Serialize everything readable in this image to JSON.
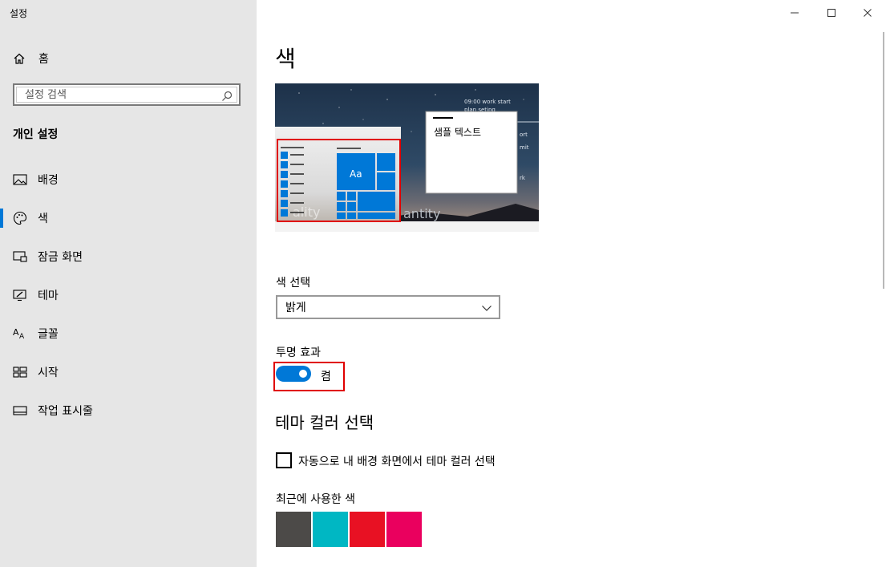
{
  "app": {
    "title": "설정"
  },
  "window_controls": {
    "minimize_icon": "minimize-icon",
    "maximize_icon": "maximize-icon",
    "close_icon": "close-icon"
  },
  "sidebar": {
    "home_label": "홈",
    "search_placeholder": "설정 검색",
    "section_heading": "개인 설정",
    "items": [
      {
        "label": "배경",
        "icon": "image-icon"
      },
      {
        "label": "색",
        "icon": "palette-icon",
        "active": true
      },
      {
        "label": "잠금 화면",
        "icon": "lock-screen-icon"
      },
      {
        "label": "테마",
        "icon": "theme-icon"
      },
      {
        "label": "글꼴",
        "icon": "font-icon"
      },
      {
        "label": "시작",
        "icon": "start-icon"
      },
      {
        "label": "작업 표시줄",
        "icon": "taskbar-icon"
      }
    ]
  },
  "main": {
    "title": "색",
    "preview": {
      "sample_text": "샘플 텍스트",
      "tile_label": "Aa",
      "bg_lines": [
        "09:00 work start",
        "plan seting",
        "ort",
        "mit",
        "rk"
      ],
      "bg_word": "antity",
      "bg_word_left": "ality"
    },
    "color_select": {
      "label": "색 선택",
      "value": "밝게"
    },
    "transparency": {
      "label": "투명 효과",
      "state": "켬",
      "on": true
    },
    "accent_heading": "테마 컬러 선택",
    "auto_pick": {
      "label": "자동으로 내 배경 화면에서 테마 컬러 선택",
      "checked": false
    },
    "recent_colors": {
      "label": "최근에 사용한 색",
      "colors": [
        "#4c4a48",
        "#00b7c3",
        "#e81123",
        "#ea005e"
      ]
    }
  },
  "colors": {
    "accent": "#0078d7",
    "highlight": "#e00000",
    "sidebar_bg": "#e6e6e6"
  }
}
